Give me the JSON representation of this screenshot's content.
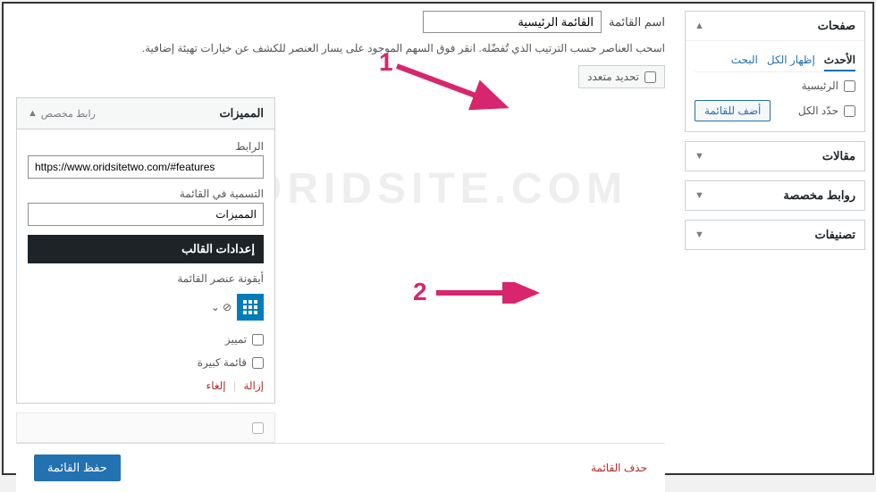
{
  "sidebar": {
    "pages": {
      "title": "صفحات",
      "tabs": {
        "recent": "الأحدث",
        "all": "إظهار الكل",
        "search": "البحث"
      },
      "item_home": "الرئيسية",
      "select_all": "حدّد الكل",
      "add_btn": "أضف للقائمة"
    },
    "posts": "مقالات",
    "custom_links": "روابط مخصصة",
    "categories": "تصنيفات"
  },
  "main": {
    "menu_name_label": "اسم القائمة",
    "menu_name_value": "القائمة الرئيسية",
    "help": "اسحب العناصر حسب الترتيب الذي تُفضّله. انقر فوق السهم الموجود على يسار العنصر للكشف عن خيارات تهيئة إضافية.",
    "bulk_select": "تحديد متعدد",
    "item": {
      "title": "المميزات",
      "type": "رابط مخصص",
      "url_label": "الرابط",
      "url_value": "https://www.oridsitetwo.com/#features",
      "label_label": "التسمية في القائمة",
      "label_value": "المميزات",
      "theme_settings": "إعدادات القالب",
      "icon_label": "أيقونة عنصر القائمة",
      "check_distinctive": "تمييز",
      "check_mega": "قائمة كبيرة",
      "remove": "إزالة",
      "cancel": "إلغاء"
    },
    "delete_menu": "حذف القائمة",
    "save_menu": "حفظ القائمة"
  },
  "watermark": "ORIDSITE.COM"
}
